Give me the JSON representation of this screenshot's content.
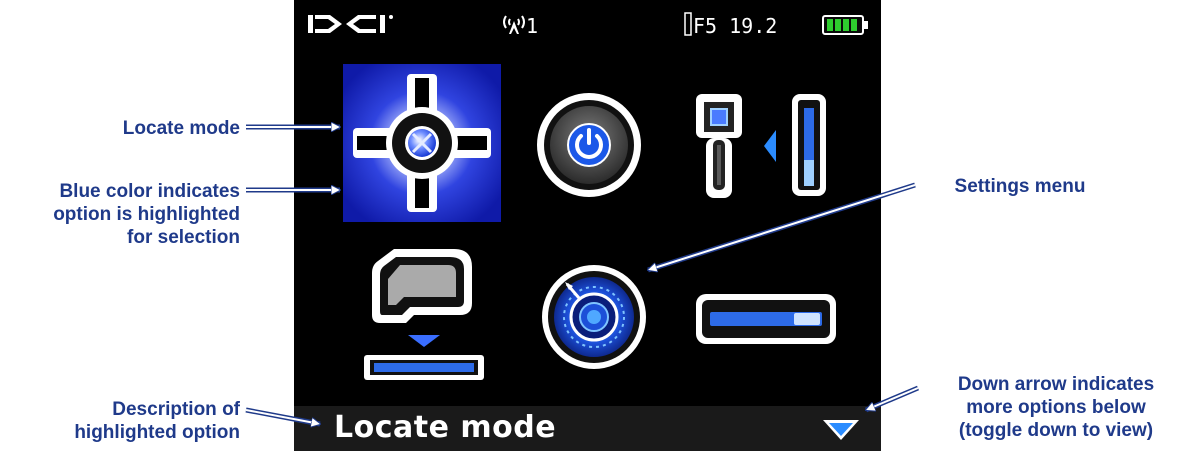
{
  "callouts": {
    "locate_mode": "Locate mode",
    "blue_color": [
      "Blue color indicates",
      "option is highlighted",
      "for selection"
    ],
    "settings_menu": "Settings menu",
    "description": [
      "Description of",
      "highlighted option"
    ],
    "down_arrow": [
      "Down arrow indicates",
      "more options below",
      "(toggle down to view)"
    ]
  },
  "status_bar": {
    "logo": "DCI",
    "signal_channel": "1",
    "transmitter_label": "F5 19.2",
    "battery_icon": "battery-full-icon"
  },
  "menu_icons": [
    {
      "name": "locate-mode-icon",
      "highlighted": true
    },
    {
      "name": "power-off-icon",
      "highlighted": false
    },
    {
      "name": "transmitter-pairing-icon",
      "highlighted": false
    },
    {
      "name": "height-above-ground-icon",
      "highlighted": false
    },
    {
      "name": "settings-menu-icon",
      "highlighted": false
    },
    {
      "name": "transmitter-calibration-icon",
      "highlighted": false
    }
  ],
  "description_bar": {
    "text": "Locate mode",
    "more_options_icon": "down-arrow-icon"
  },
  "colors": {
    "callout_text": "#1f3a8a",
    "highlight_blue": "#1c2ac6",
    "screen_background": "#000000",
    "battery_green": "#2ecc2e"
  }
}
